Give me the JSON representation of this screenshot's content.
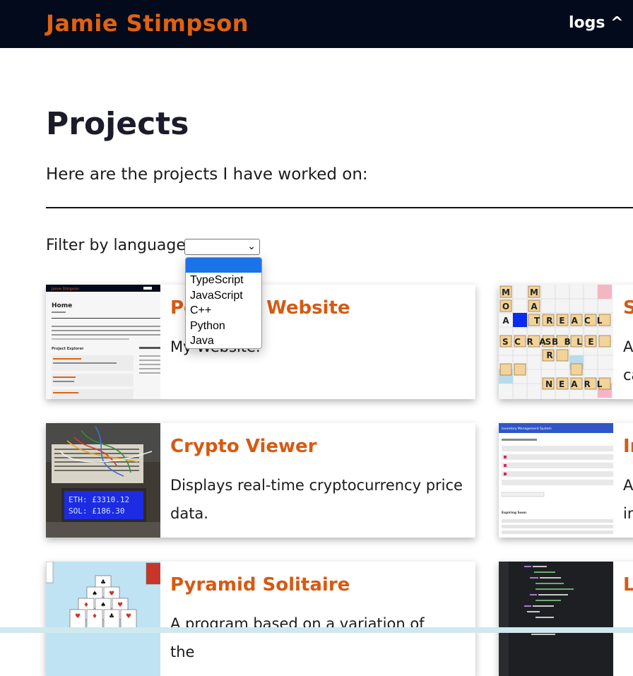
{
  "header": {
    "brand": "Jamie Stimpson",
    "nav_link": "logs ^"
  },
  "page": {
    "title": "Projects",
    "intro": "Here are the projects I have worked on:",
    "filter_label": "Filter by language:",
    "filter_selected": "",
    "filter_options": [
      "",
      "TypeScript",
      "JavaScript",
      "C++",
      "Python",
      "Java"
    ]
  },
  "projects": [
    {
      "title": "Portfolio Website",
      "desc": "My Website."
    },
    {
      "title": "S",
      "desc": "A ca"
    },
    {
      "title": "Crypto Viewer",
      "desc": "Displays real-time cryptocurrency price data."
    },
    {
      "title": "In",
      "desc": "A in"
    },
    {
      "title": "Pyramid Solitaire",
      "desc": "A program based on a variation of the"
    },
    {
      "title": "L",
      "desc": ""
    }
  ],
  "thumbs": {
    "website_preview": {
      "heading": "Home",
      "brand": "Jamie Stimpson",
      "section": "Project Explorer"
    },
    "scrabble_words": [
      "TREACL",
      "SCRABBLE",
      "NEARL"
    ],
    "crypto_lcd": [
      "ETH: £3310.12",
      "SOL: £186.30"
    ],
    "inventory_header": "Inventory Management System",
    "inventory_section": "Expiring Soon"
  }
}
